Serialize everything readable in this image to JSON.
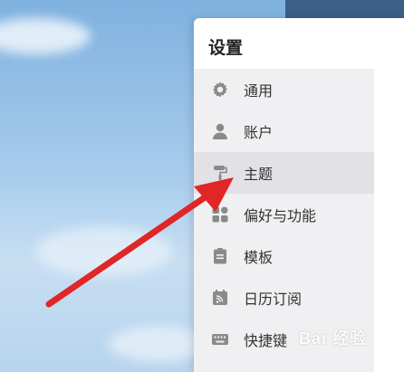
{
  "settings": {
    "title": "设置",
    "items": [
      {
        "label": "通用",
        "icon": "gear-icon"
      },
      {
        "label": "账户",
        "icon": "user-icon"
      },
      {
        "label": "主题",
        "icon": "paint-roller-icon",
        "active": true
      },
      {
        "label": "偏好与功能",
        "icon": "grid-icon"
      },
      {
        "label": "模板",
        "icon": "template-icon"
      },
      {
        "label": "日历订阅",
        "icon": "calendar-rss-icon"
      },
      {
        "label": "快捷键",
        "icon": "keyboard-icon"
      }
    ]
  },
  "watermark": "Bai 经验",
  "colors": {
    "arrow": "#e02626",
    "sidebar_bg": "#f0f0f2",
    "active_bg": "#e2e2e6",
    "icon": "#8a8a8a"
  }
}
